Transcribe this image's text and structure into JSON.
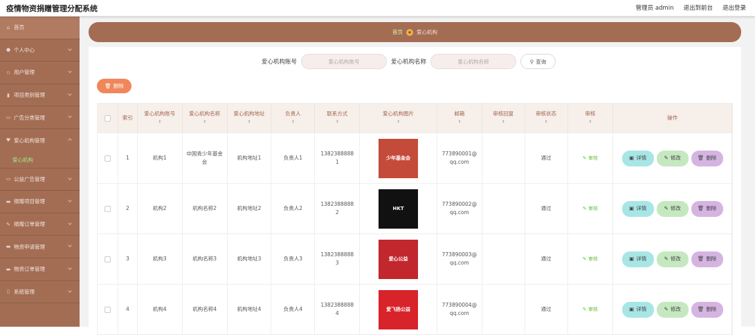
{
  "app": {
    "title": "疫情物资捐赠管理分配系统"
  },
  "topbar": {
    "user": "管理员 admin",
    "back_front": "退出到前台",
    "logout": "退出登录"
  },
  "sidebar": {
    "items": [
      {
        "label": "首页",
        "icon": "home-icon"
      },
      {
        "label": "个人中心",
        "icon": "user-icon"
      },
      {
        "label": "用户管理",
        "icon": "users-icon"
      },
      {
        "label": "项目类别管理",
        "icon": "chart-icon"
      },
      {
        "label": "广告分类管理",
        "icon": "tag-icon"
      },
      {
        "label": "爱心机构管理",
        "icon": "heart-icon"
      },
      {
        "label": "公益广告管理",
        "icon": "ad-icon"
      },
      {
        "label": "捐赠项目管理",
        "icon": "project-icon"
      },
      {
        "label": "捐赠订单管理",
        "icon": "order-icon"
      },
      {
        "label": "物资申请管理",
        "icon": "apply-icon"
      },
      {
        "label": "物资订单管理",
        "icon": "box-icon"
      },
      {
        "label": "系统管理",
        "icon": "system-icon"
      }
    ],
    "sub_active": "爱心机构"
  },
  "breadcrumb": {
    "home": "首页",
    "current": "爱心机构"
  },
  "search": {
    "account_label": "爱心机构账号",
    "account_placeholder": "爱心机构账号",
    "name_label": "爱心机构名称",
    "name_placeholder": "爱心机构名称",
    "query_label": "查询"
  },
  "toolbar": {
    "delete_label": "删除"
  },
  "table": {
    "headers": {
      "index": "索引",
      "account": "爱心机构账号",
      "name": "爱心机构名称",
      "address": "爱心机构地址",
      "person": "负责人",
      "phone": "联系方式",
      "image": "爱心机构图片",
      "email": "邮箱",
      "reply": "审核回复",
      "status": "审核状态",
      "audit": "审核",
      "actions": "操作"
    },
    "action_labels": {
      "view": "详情",
      "edit": "修改",
      "delete": "删除",
      "audit": "审核"
    },
    "rows": [
      {
        "index": "1",
        "account": "机构1",
        "name": "中国青少年基金会",
        "address": "机构地址1",
        "person": "负责人1",
        "phone": "13823888881",
        "email": "773890001@qq.com",
        "reply": "",
        "status": "通过",
        "image_text": "少年基金会",
        "image_bg": "#c44a3a"
      },
      {
        "index": "2",
        "account": "机构2",
        "name": "机构名称2",
        "address": "机构地址2",
        "person": "负责人2",
        "phone": "13823888882",
        "email": "773890002@qq.com",
        "reply": "",
        "status": "通过",
        "image_text": "HKT",
        "image_bg": "#111111"
      },
      {
        "index": "3",
        "account": "机构3",
        "name": "机构名称3",
        "address": "机构地址3",
        "person": "负责人3",
        "phone": "13823888883",
        "email": "773890003@qq.com",
        "reply": "",
        "status": "通过",
        "image_text": "爱心公益",
        "image_bg": "#c1272d"
      },
      {
        "index": "4",
        "account": "机构4",
        "name": "机构名称4",
        "address": "机构地址4",
        "person": "负责人4",
        "phone": "13823888884",
        "email": "773890004@qq.com",
        "reply": "",
        "status": "通过",
        "image_text": "爱飞扬公益",
        "image_bg": "#d8232a"
      }
    ]
  }
}
